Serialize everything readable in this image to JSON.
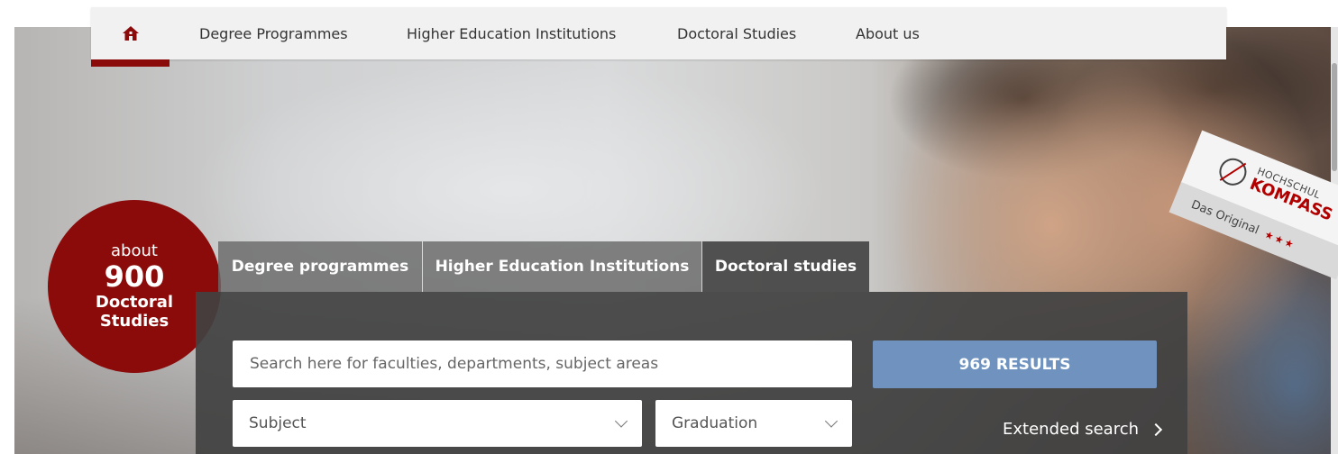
{
  "nav": {
    "home_icon": "home-icon",
    "items": [
      {
        "label": "Degree Programmes"
      },
      {
        "label": "Higher Education Institutions"
      },
      {
        "label": "Doctoral Studies"
      },
      {
        "label": "About us"
      }
    ]
  },
  "badge": {
    "about": "about",
    "number": "900",
    "line1": "Doctoral",
    "line2": "Studies"
  },
  "tabs": [
    {
      "label": "Degree programmes"
    },
    {
      "label": "Higher Education Institutions"
    },
    {
      "label": "Doctoral studies",
      "active": true
    }
  ],
  "search": {
    "placeholder": "Search here for faculties, departments, subject areas",
    "results_label": "969 RESULTS",
    "subject": "Subject",
    "graduation": "Graduation",
    "extended": "Extended search"
  },
  "logo": {
    "hochschul": "HOCHSCHUL",
    "kompass": "KOMPASS",
    "tagline": "Das Original",
    "stars": "★★★"
  },
  "colors": {
    "brand_red": "#8b0a0a",
    "results_blue": "#6f93be",
    "panel_dark": "#424242",
    "nav_bg": "#f1f1f1"
  }
}
